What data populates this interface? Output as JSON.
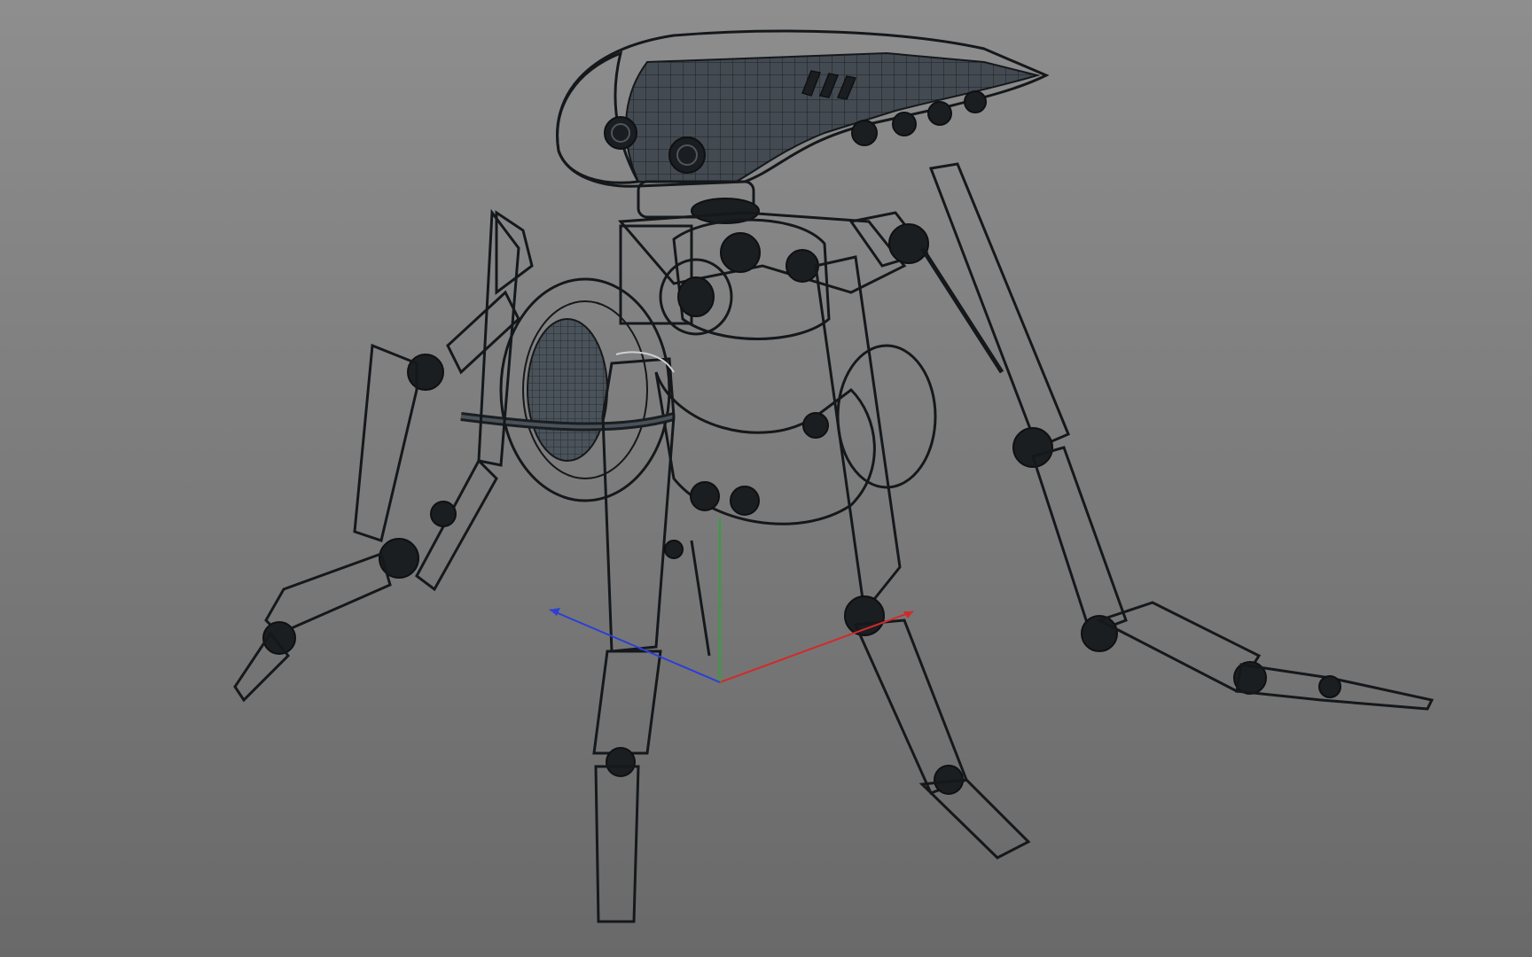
{
  "viewport": {
    "background_top": "#8e8e8e",
    "background_bottom": "#696969"
  },
  "model": {
    "mesh_color": "#3f464d",
    "wire_color": "#1e2226",
    "highlight_color": "#59626b"
  },
  "gizmo": {
    "x_axis_color": "#d22a2a",
    "y_axis_color": "#2fa33a",
    "z_axis_color": "#2b3fd6"
  }
}
